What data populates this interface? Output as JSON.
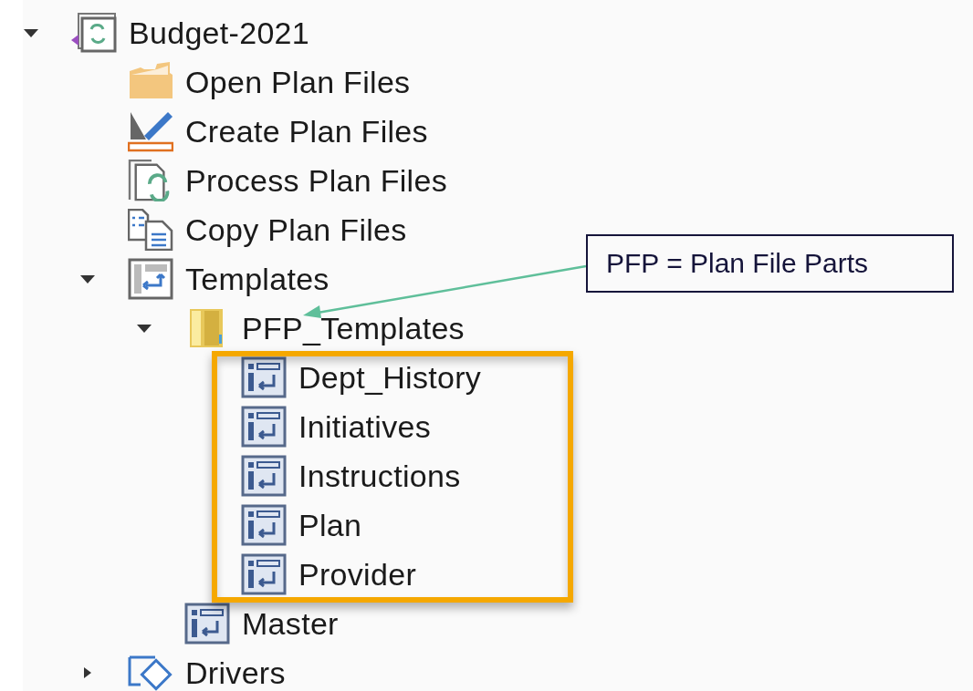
{
  "tree": [
    {
      "label": "Budget-2021",
      "kind": "app",
      "expanded": true,
      "children": [
        {
          "label": "Open Plan Files",
          "kind": "folder"
        },
        {
          "label": "Create Plan Files",
          "kind": "create"
        },
        {
          "label": "Process Plan Files",
          "kind": "process"
        },
        {
          "label": "Copy Plan Files",
          "kind": "copy"
        },
        {
          "label": "Templates",
          "kind": "template-frame",
          "expanded": true,
          "children": [
            {
              "label": "PFP_Templates",
              "kind": "yellow-folder",
              "expanded": true,
              "children_highlighted": true,
              "children": [
                {
                  "label": "Dept_History",
                  "kind": "template"
                },
                {
                  "label": "Initiatives",
                  "kind": "template"
                },
                {
                  "label": "Instructions",
                  "kind": "template"
                },
                {
                  "label": "Plan",
                  "kind": "template"
                },
                {
                  "label": "Provider",
                  "kind": "template"
                }
              ]
            },
            {
              "label": "Master",
              "kind": "template"
            }
          ]
        },
        {
          "label": "Drivers",
          "kind": "driver",
          "expanded": false
        }
      ]
    }
  ],
  "callout": {
    "text": "PFP = Plan File Parts"
  }
}
